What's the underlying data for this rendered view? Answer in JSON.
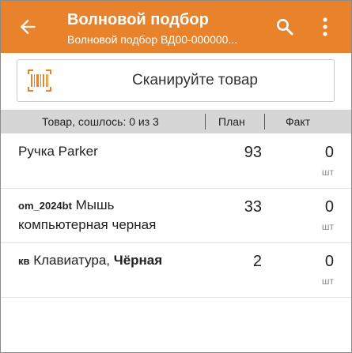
{
  "appbar": {
    "title": "Волновой подбор",
    "subtitle": "Волновой подбор ВД00-000000...",
    "color": "#e8832b",
    "icons": [
      "back-arrow-icon",
      "search-icon",
      "more-vert-icon"
    ]
  },
  "scan": {
    "label": "Сканируйте товар",
    "icon": "barcode-icon",
    "icon_color": "#e8832b"
  },
  "table": {
    "header": {
      "goods": "Товар, сошлось: 0 из 3",
      "plan": "План",
      "fact": "Факт"
    },
    "rows": [
      {
        "prefix": "",
        "name": "Ручка Parker",
        "name_bold": "",
        "plan": "93",
        "fact": "0",
        "unit": "шт"
      },
      {
        "prefix": "om_2024bt",
        "name": " Мышь компьютерная черная",
        "name_bold": "",
        "plan": "33",
        "fact": "0",
        "unit": "шт"
      },
      {
        "prefix": "кв",
        "name": " Клавиатура, ",
        "name_bold": "Чёрная",
        "plan": "2",
        "fact": "0",
        "unit": "шт"
      }
    ]
  }
}
